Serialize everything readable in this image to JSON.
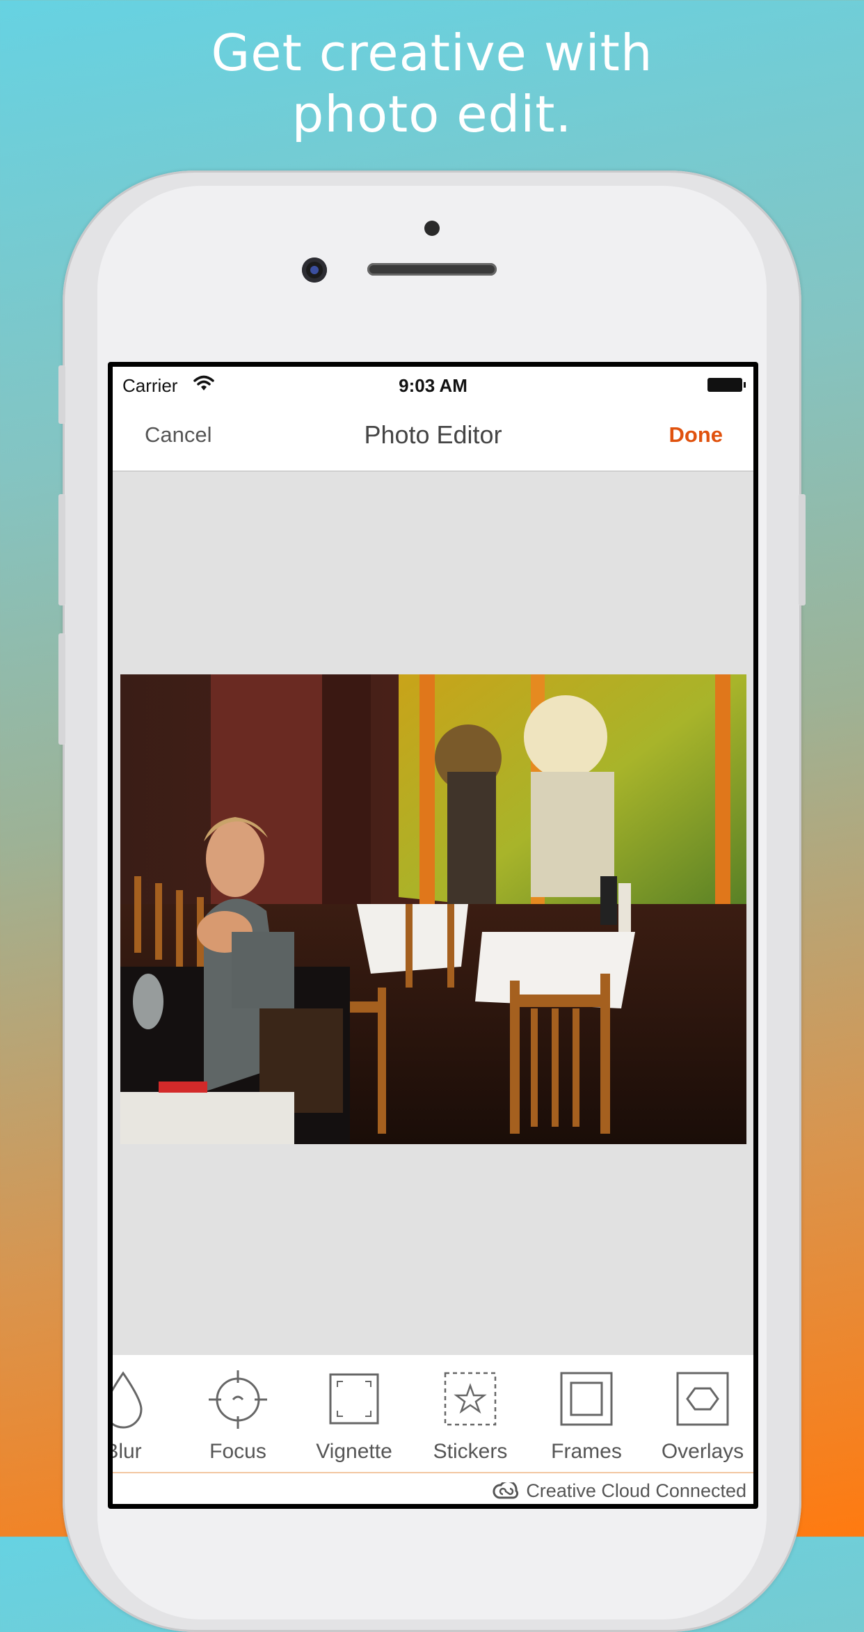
{
  "headline": {
    "line1": "Get creative with",
    "line2": "photo edit."
  },
  "status": {
    "carrier": "Carrier",
    "time": "9:03 AM"
  },
  "navbar": {
    "cancel": "Cancel",
    "title": "Photo Editor",
    "done": "Done"
  },
  "tools": [
    {
      "label": "Blur",
      "icon": "drop-icon"
    },
    {
      "label": "Focus",
      "icon": "crosshair-icon"
    },
    {
      "label": "Vignette",
      "icon": "vignette-icon"
    },
    {
      "label": "Stickers",
      "icon": "star-icon"
    },
    {
      "label": "Frames",
      "icon": "frame-icon"
    },
    {
      "label": "Overlays",
      "icon": "hexagon-icon"
    }
  ],
  "footer": {
    "brand": "Creative Cloud Connected"
  },
  "colors": {
    "accent": "#e0520e"
  }
}
